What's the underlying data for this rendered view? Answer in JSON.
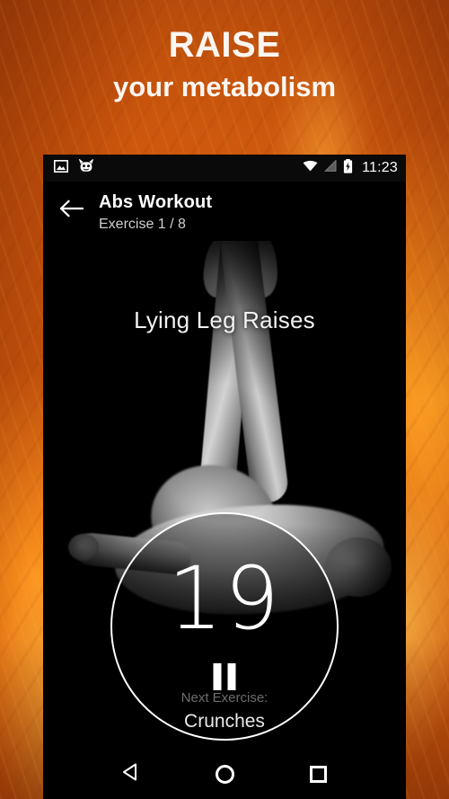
{
  "promo": {
    "headline_line1": "RAISE",
    "headline_line2": "your metabolism",
    "background_color": "#c8540d",
    "accent_color": "#ffa230",
    "text_color": "#fbf6f1"
  },
  "phone": {
    "status_bar": {
      "time": "11:23",
      "icons_left": [
        "image-icon",
        "cyanogenmod-robot-icon"
      ],
      "icons_right": [
        "wifi-icon",
        "cell-signal-icon",
        "battery-charging-icon"
      ]
    },
    "app_bar": {
      "back_icon": "arrow-left-icon",
      "title": "Abs Workout",
      "subtitle": "Exercise 1 / 8"
    },
    "exercise": {
      "name": "Lying Leg Raises",
      "photo_alt": "lying-leg-raises-photo",
      "timer_value": "19",
      "timer_state_icon": "pause-icon",
      "ring_color": "#ffffff",
      "next_label": "Next Exercise:",
      "next_name": "Crunches"
    },
    "nav_bar": {
      "back": "nav-back-icon",
      "home": "nav-home-icon",
      "recents": "nav-recents-icon"
    }
  }
}
